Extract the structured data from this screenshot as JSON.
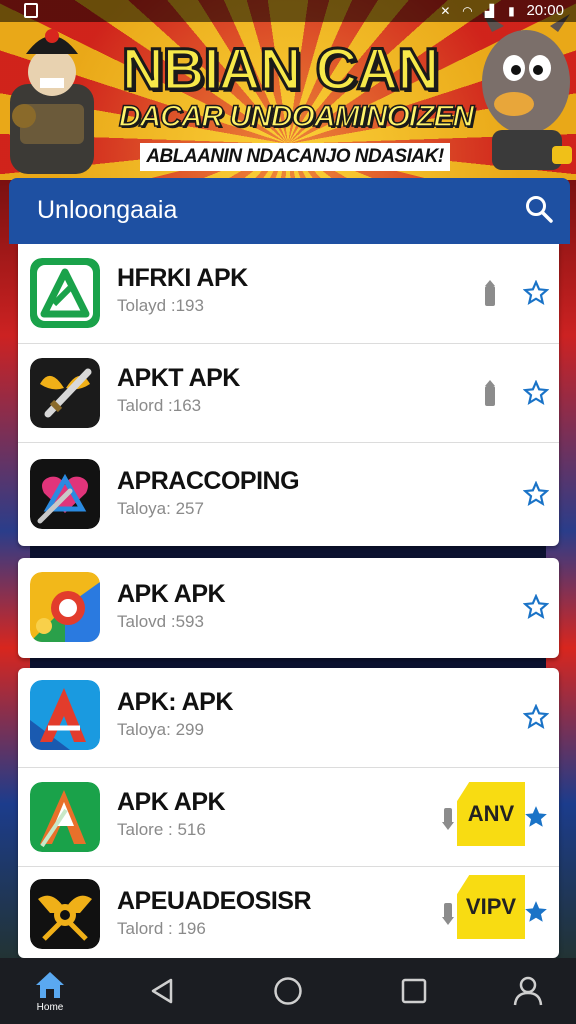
{
  "status_bar": {
    "time": "20:00"
  },
  "banner": {
    "title": "NBIAN CAN",
    "subtitle": "DACAR UNDOAMINOIZEN",
    "tagline": "ABLAANIN NDACANJO NDASIAK!"
  },
  "panel": {
    "title": "Unloongaaia",
    "search_icon": "search-icon"
  },
  "apps": [
    {
      "name": "HFRKI APK",
      "meta": "Tolayd :193",
      "icon": "green-triangle-icon",
      "download": true,
      "badge": "",
      "starred": false
    },
    {
      "name": "APKT APK",
      "meta": "Talord :163",
      "icon": "sword-icon",
      "download": true,
      "badge": "",
      "starred": false
    },
    {
      "name": "APRACCOPING",
      "meta": "Taloya: 257",
      "icon": "heart-tool-icon",
      "download": false,
      "badge": "",
      "starred": false
    },
    {
      "name": "APK APK",
      "meta": "Talovd :593",
      "icon": "chrome-like-icon",
      "download": false,
      "badge": "",
      "starred": false
    },
    {
      "name": "APK: APK",
      "meta": "Taloya: 299",
      "icon": "red-a-icon",
      "download": false,
      "badge": "",
      "starred": false
    },
    {
      "name": "APK APK",
      "meta": "Talore : 516",
      "icon": "green-a-icon",
      "download": true,
      "badge": "ANV",
      "starred": true
    },
    {
      "name": "APEUADEOSISR",
      "meta": "Talord : 196",
      "icon": "gold-emblem-icon",
      "download": true,
      "badge": "VIPV",
      "starred": true
    }
  ],
  "navbar": {
    "home_label": "Home",
    "items": [
      "home-icon",
      "back-icon",
      "home-circle-icon",
      "recents-icon",
      "profile-icon"
    ]
  },
  "colors": {
    "panel_blue": "#1e50a2",
    "star_blue": "#1a73c7",
    "badge_yellow": "#f8dc12"
  }
}
